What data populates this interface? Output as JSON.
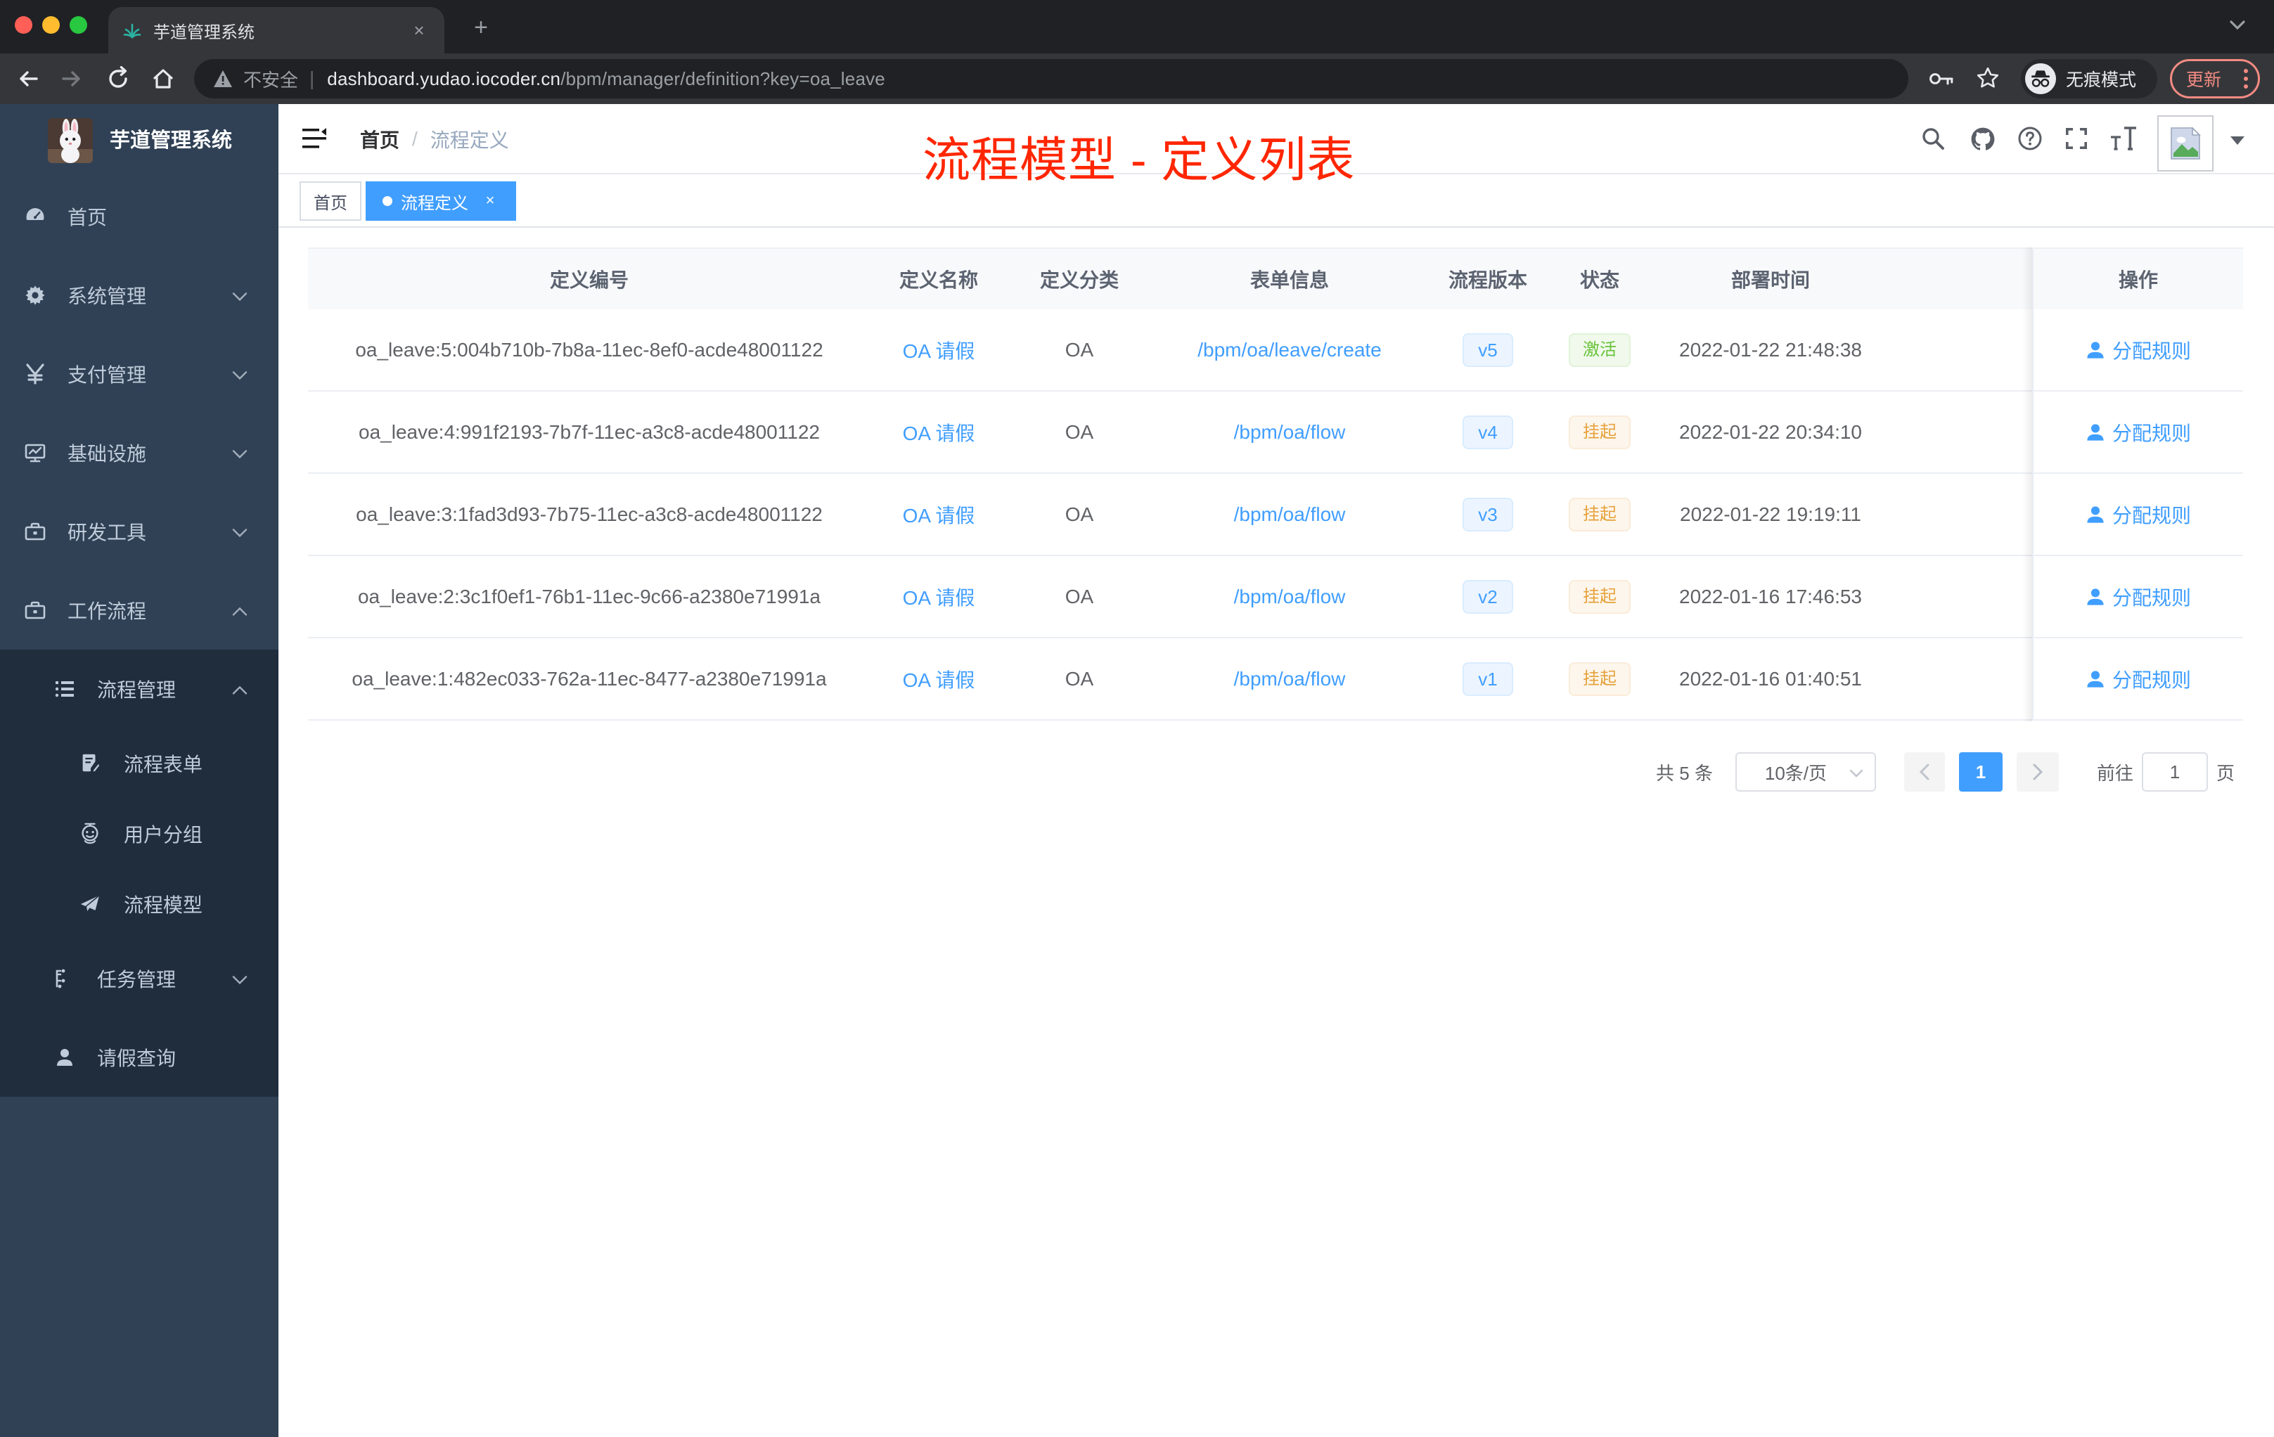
{
  "browser": {
    "tab_title": "芋道管理系统",
    "new_tab": "+",
    "close_tab": "×",
    "url_warning": "不安全",
    "url_domain": "dashboard.yudao.iocoder.cn",
    "url_path": "/bpm/manager/definition?key=oa_leave",
    "incognito_label": "无痕模式",
    "update_label": "更新"
  },
  "sidebar": {
    "logo_title": "芋道管理系统",
    "items": [
      {
        "label": "首页",
        "icon": "dashboard-icon"
      },
      {
        "label": "系统管理",
        "icon": "gear-icon",
        "arrow": "down"
      },
      {
        "label": "支付管理",
        "icon": "yen-icon",
        "arrow": "down"
      },
      {
        "label": "基础设施",
        "icon": "monitor-icon",
        "arrow": "down"
      },
      {
        "label": "研发工具",
        "icon": "toolbox-icon",
        "arrow": "down"
      },
      {
        "label": "工作流程",
        "icon": "toolbox-icon",
        "arrow": "up"
      }
    ],
    "submenu": [
      {
        "label": "流程管理",
        "icon": "list-icon",
        "arrow": "up",
        "level": 2
      },
      {
        "label": "流程表单",
        "icon": "form-icon",
        "level": 3
      },
      {
        "label": "用户分组",
        "icon": "robot-icon",
        "level": 3
      },
      {
        "label": "流程模型",
        "icon": "paper-plane-icon",
        "level": 3
      },
      {
        "label": "任务管理",
        "icon": "tree-icon",
        "arrow": "down",
        "level": 2
      },
      {
        "label": "请假查询",
        "icon": "user-icon",
        "level": 2
      }
    ]
  },
  "header": {
    "breadcrumb_home": "首页",
    "breadcrumb_sep": "/",
    "breadcrumb_current": "流程定义"
  },
  "annotation": {
    "text": "流程模型 - 定义列表",
    "color": "#ff2600"
  },
  "tags": {
    "first": "首页",
    "active": "流程定义"
  },
  "table": {
    "columns": [
      "定义编号",
      "定义名称",
      "定义分类",
      "表单信息",
      "流程版本",
      "状态",
      "部署时间",
      "操作"
    ],
    "rows": [
      {
        "id": "oa_leave:5:004b710b-7b8a-11ec-8ef0-acde48001122",
        "name": "OA 请假",
        "category": "OA",
        "form": "/bpm/oa/leave/create",
        "version": "v5",
        "status": "激活",
        "status_type": "success",
        "time": "2022-01-22 21:48:38",
        "action": "分配规则"
      },
      {
        "id": "oa_leave:4:991f2193-7b7f-11ec-a3c8-acde48001122",
        "name": "OA 请假",
        "category": "OA",
        "form": "/bpm/oa/flow",
        "version": "v4",
        "status": "挂起",
        "status_type": "warning",
        "time": "2022-01-22 20:34:10",
        "action": "分配规则"
      },
      {
        "id": "oa_leave:3:1fad3d93-7b75-11ec-a3c8-acde48001122",
        "name": "OA 请假",
        "category": "OA",
        "form": "/bpm/oa/flow",
        "version": "v3",
        "status": "挂起",
        "status_type": "warning",
        "time": "2022-01-22 19:19:11",
        "action": "分配规则"
      },
      {
        "id": "oa_leave:2:3c1f0ef1-76b1-11ec-9c66-a2380e71991a",
        "name": "OA 请假",
        "category": "OA",
        "form": "/bpm/oa/flow",
        "version": "v2",
        "status": "挂起",
        "status_type": "warning",
        "time": "2022-01-16 17:46:53",
        "action": "分配规则"
      },
      {
        "id": "oa_leave:1:482ec033-762a-11ec-8477-a2380e71991a",
        "name": "OA 请假",
        "category": "OA",
        "form": "/bpm/oa/flow",
        "version": "v1",
        "status": "挂起",
        "status_type": "warning",
        "time": "2022-01-16 01:40:51",
        "action": "分配规则"
      }
    ]
  },
  "pagination": {
    "total": "共 5 条",
    "page_size": "10条/页",
    "current_page": "1",
    "goto_label": "前往",
    "goto_value": "1",
    "page_unit": "页"
  }
}
